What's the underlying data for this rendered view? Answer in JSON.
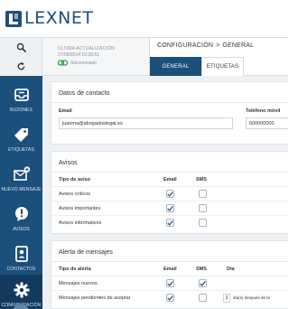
{
  "app": {
    "name": "LEXNET"
  },
  "toolbar": {
    "search_icon": "search-icon",
    "refresh_icon": "refresh-icon"
  },
  "sidebar": {
    "items": [
      {
        "label": "BUZONES",
        "icon": "inbox-icon"
      },
      {
        "label": "ETIQUETAS",
        "icon": "tag-icon"
      },
      {
        "label": "NUEVO MENSAJE",
        "icon": "new-message-icon"
      },
      {
        "label": "AVISOS",
        "icon": "alert-icon"
      },
      {
        "label": "CONTACTOS",
        "icon": "contacts-icon"
      },
      {
        "label": "CONFIGURACIÓN",
        "icon": "gear-icon"
      }
    ],
    "active": "CONFIGURACIÓN"
  },
  "sync": {
    "label": "ÚLTIMA ACTUALIZACIÓN:",
    "date": "27/08/2014 10:33:51",
    "status": "Sincronizado"
  },
  "breadcrumb": {
    "section": "CONFIGURACIÓN",
    "separator": ">",
    "page": "GENERAL"
  },
  "tabs": [
    {
      "label": "GENERAL",
      "active": true
    },
    {
      "label": "ETIQUETAS",
      "active": false
    }
  ],
  "contact": {
    "title": "Datos de contacto",
    "email_label": "Email",
    "email_value": "juanma@abogadoslegal.es",
    "phone_label": "Teléfono móvil",
    "phone_value": "600000000"
  },
  "avisos": {
    "title": "Avisos",
    "col_type": "Tipo de aviso",
    "col_email": "Email",
    "col_sms": "SMS",
    "rows": [
      {
        "label": "Avisos críticos",
        "email": true,
        "sms": false
      },
      {
        "label": "Avisos importantes",
        "email": true,
        "sms": false
      },
      {
        "label": "Avisos informativos",
        "email": true,
        "sms": false
      }
    ]
  },
  "alerta": {
    "title": "Alerta de mensajes",
    "col_type": "Tipo de alerta",
    "col_email": "Email",
    "col_sms": "SMS",
    "col_day": "Día",
    "rows": [
      {
        "label": "Mensajes nuevos",
        "email": true,
        "sms": true
      },
      {
        "label": "Mensajes pendientes de aceptar",
        "email": true,
        "sms": false,
        "days": "3",
        "days_text": "día(s) después de la"
      }
    ]
  },
  "colors": {
    "brand": "#1b4f7c",
    "brand_dark": "#123a5d",
    "sync_green": "#2f9e44",
    "check": "#1b4f7c"
  }
}
